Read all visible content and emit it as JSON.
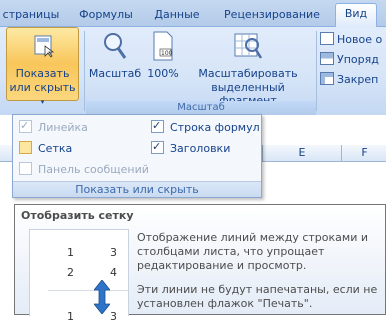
{
  "tabs": [
    {
      "label": "страницы"
    },
    {
      "label": "Формулы"
    },
    {
      "label": "Данные"
    },
    {
      "label": "Рецензирование"
    },
    {
      "label": "Вид"
    }
  ],
  "ribbon": {
    "show_hide_label": "Показать или скрыть",
    "show_hide_line1": "Показать",
    "show_hide_line2": "или скрыть",
    "zoom_label": "Масштаб",
    "zoom_100_label": "100%",
    "zoom_selection_line1": "Масштабировать",
    "zoom_selection_line2": "выделенный фрагмент",
    "group_zoom_label": "Масштаб",
    "window_commands": [
      "Новое о",
      "Упоряд",
      "Закреп"
    ]
  },
  "sheet": {
    "column_headers": [
      "E",
      "F"
    ]
  },
  "dropdown": {
    "items": [
      {
        "label": "Линейка",
        "checked": true,
        "disabled": true
      },
      {
        "label": "Строка формул",
        "checked": true,
        "disabled": false
      },
      {
        "label": "Сетка",
        "checked": false,
        "disabled": false
      },
      {
        "label": "Заголовки",
        "checked": true,
        "disabled": false
      },
      {
        "label": "Панель сообщений",
        "checked": false,
        "disabled": true
      }
    ],
    "group_label": "Показать или скрыть"
  },
  "tooltip": {
    "title": "Отобразить сетку",
    "line1": "Отображение линий между строками и",
    "line2": "столбцами листа, что упрощает",
    "line3": "редактирование и просмотр.",
    "line4": "Эти линии не будут напечатаны, если не",
    "line5": "установлен флажок \"Печать\".",
    "preview_numbers": [
      "1",
      "3",
      "2",
      "4",
      "1",
      "3"
    ]
  },
  "colors": {
    "ribbon_bg": "#dbe7f7",
    "selected_button": "#f9c65a",
    "text": "#15428b"
  }
}
